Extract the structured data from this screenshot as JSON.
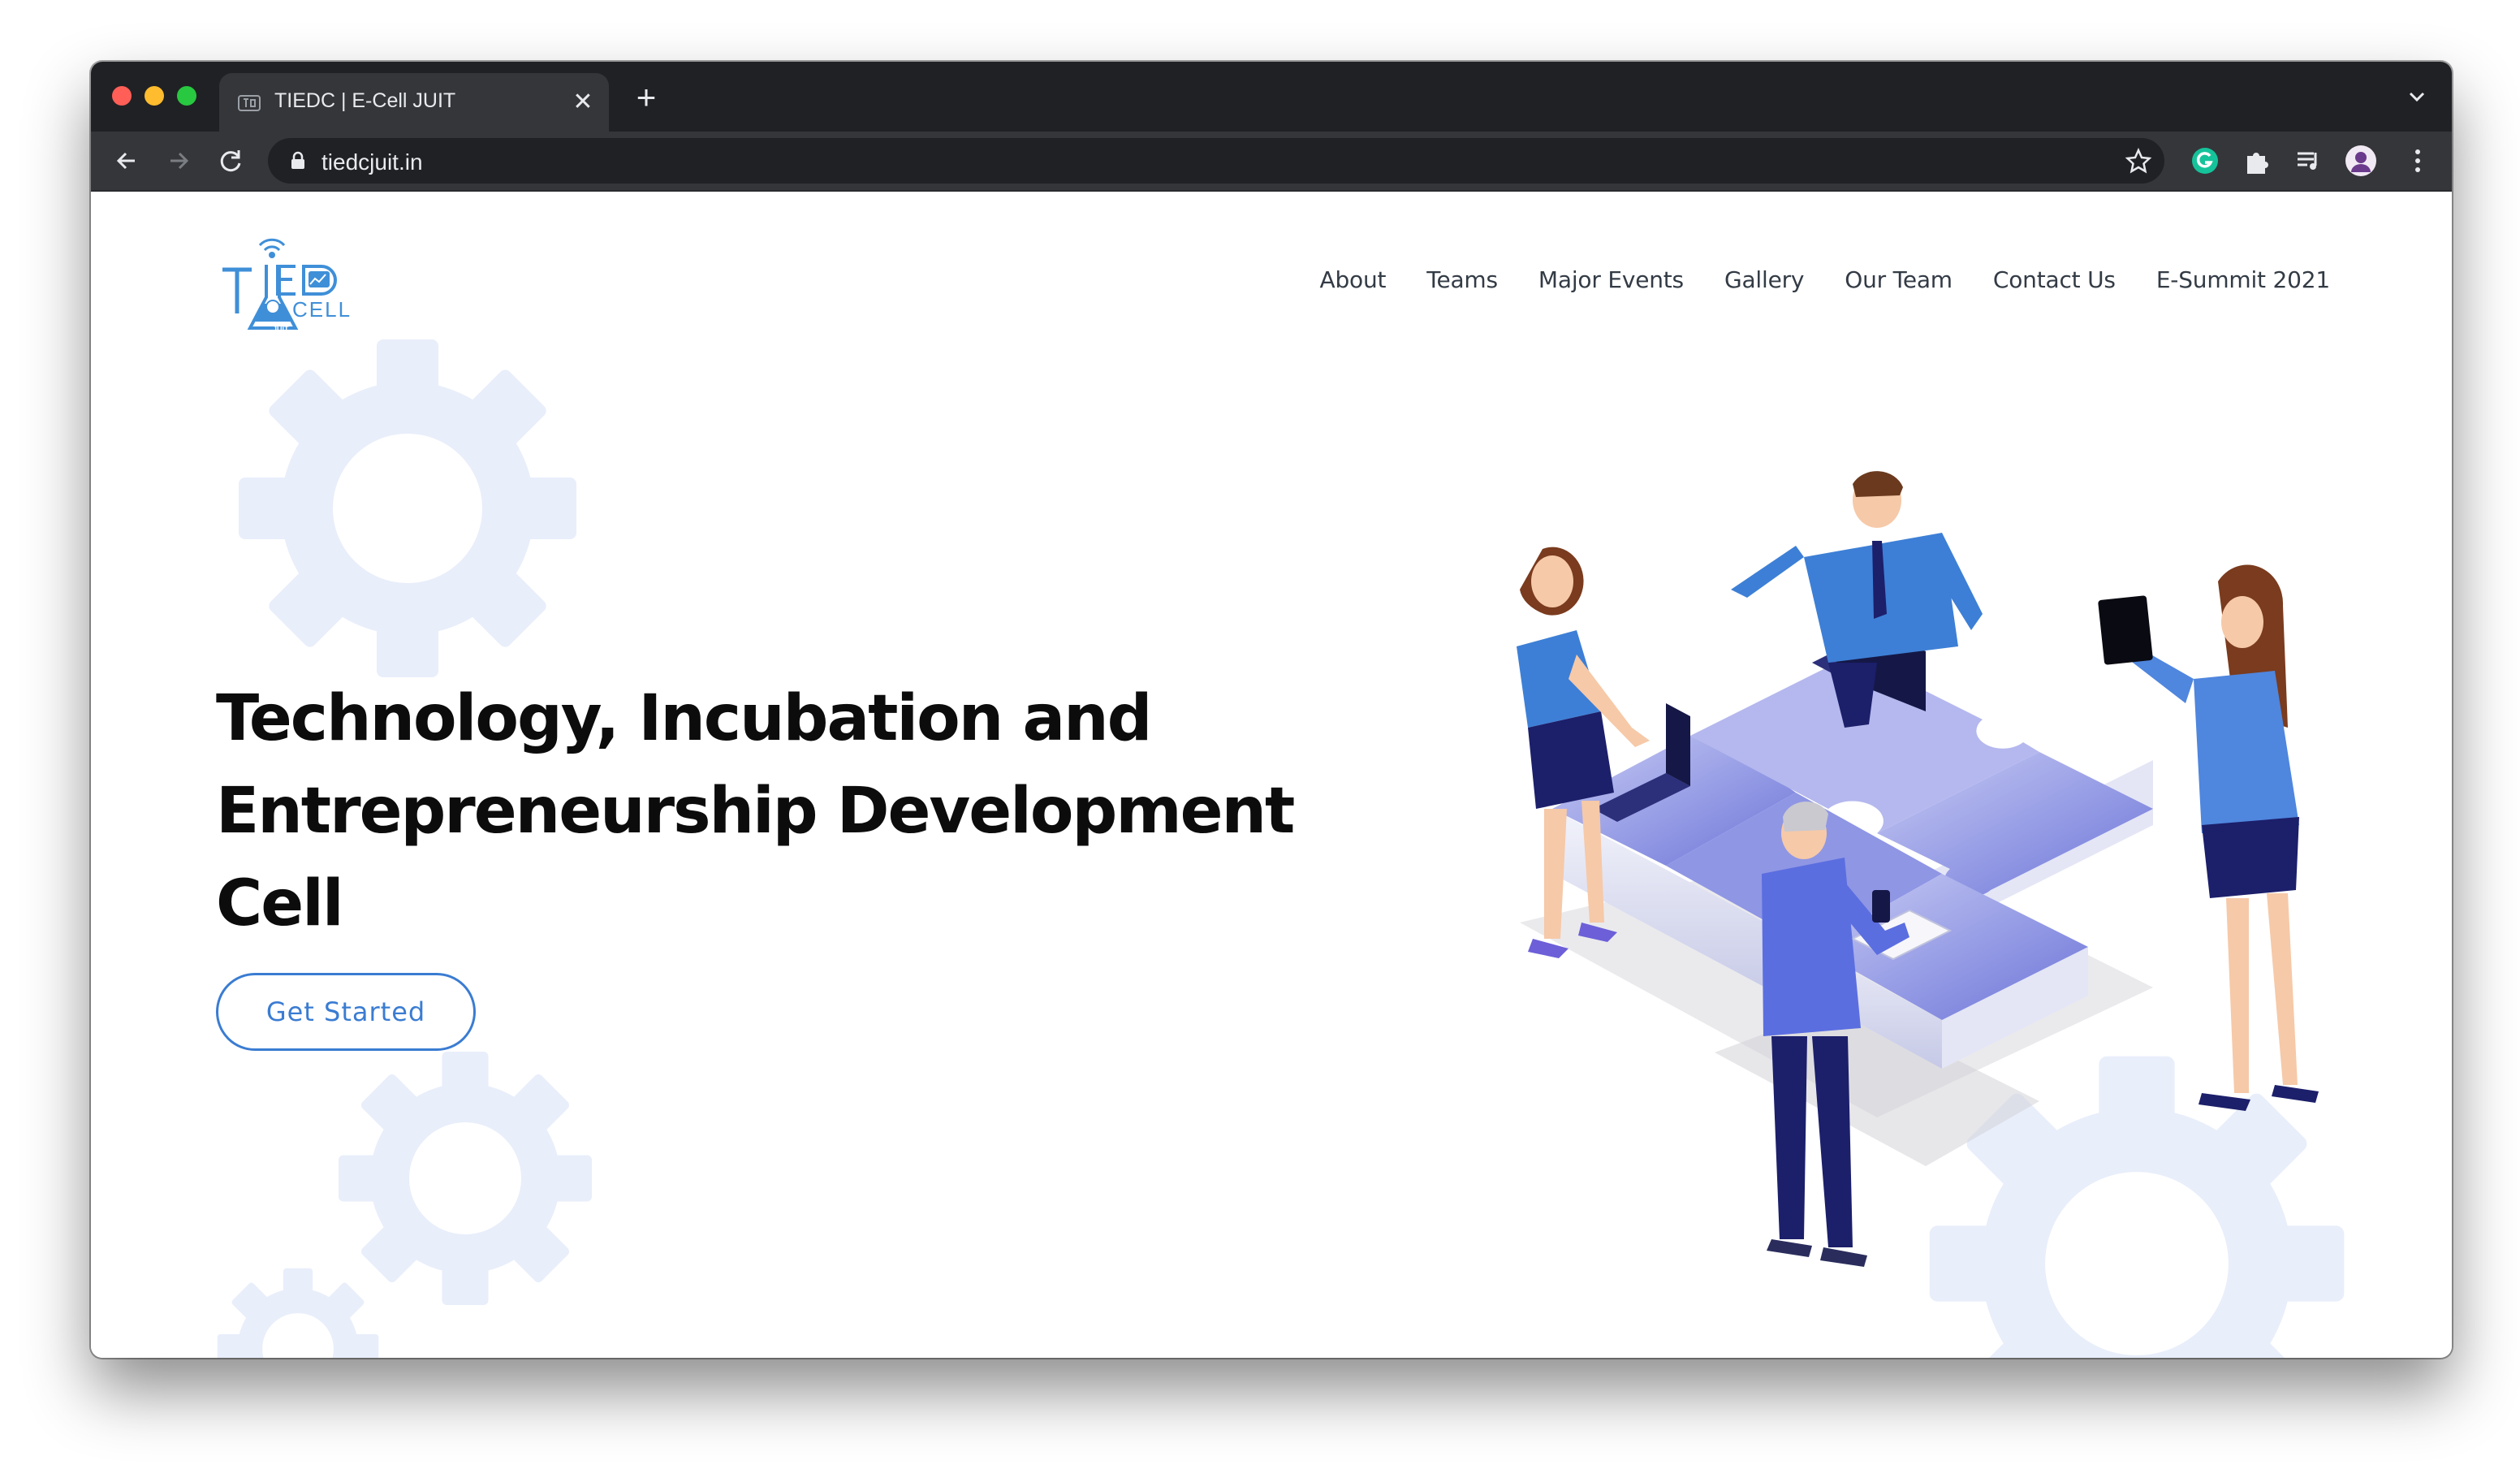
{
  "browser": {
    "tab": {
      "title": "TIEDC | E-Cell JUIT",
      "favicon": "tiedc-logo-icon"
    },
    "address_bar": {
      "url": "tiedcjuit.in"
    },
    "extensions": [
      "grammarly-icon",
      "puzzle-icon",
      "media-control-icon",
      "profile-avatar-icon"
    ]
  },
  "header": {
    "logo": {
      "brand": "TIEDC CELL",
      "sub": "JUIT"
    },
    "nav": [
      {
        "label": "About"
      },
      {
        "label": "Teams"
      },
      {
        "label": "Major Events"
      },
      {
        "label": "Gallery"
      },
      {
        "label": "Our Team"
      },
      {
        "label": "Contact Us"
      },
      {
        "label": "E-Summit 2021"
      }
    ]
  },
  "hero": {
    "title_line1": "Technology, Incubation and",
    "title_line2": "Entrepreneurship Development Cell",
    "cta_label": "Get Started"
  },
  "colors": {
    "accent": "#3a7cd2",
    "gear": "#e8eefa",
    "title": "#0c0c0c",
    "chrome_dark": "#202124",
    "chrome_toolbar": "#35363a"
  }
}
